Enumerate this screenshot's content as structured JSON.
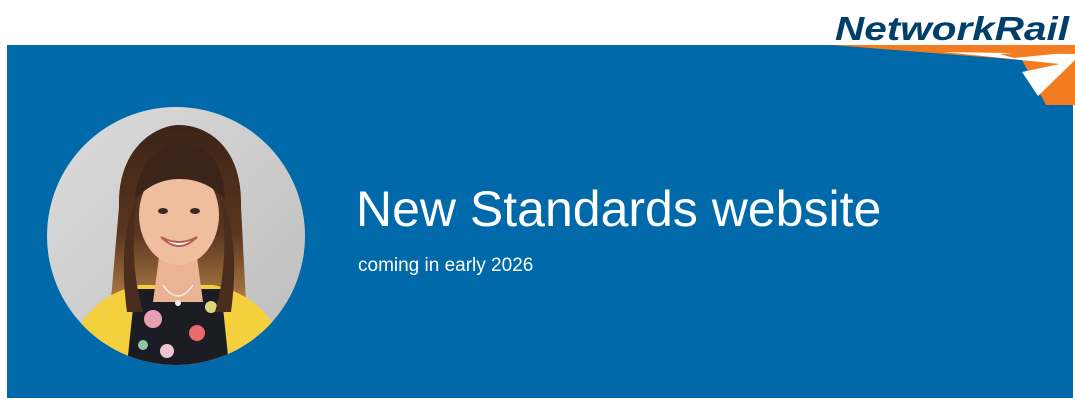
{
  "banner": {
    "headline": "New Standards website",
    "subline": "coming in early 2026",
    "background_color": "#0069aa"
  },
  "logo": {
    "text": "NetworkRail",
    "text_color": "#003f69",
    "arrow_color": "#f47c20"
  },
  "photo": {
    "icon": "person-portrait"
  }
}
